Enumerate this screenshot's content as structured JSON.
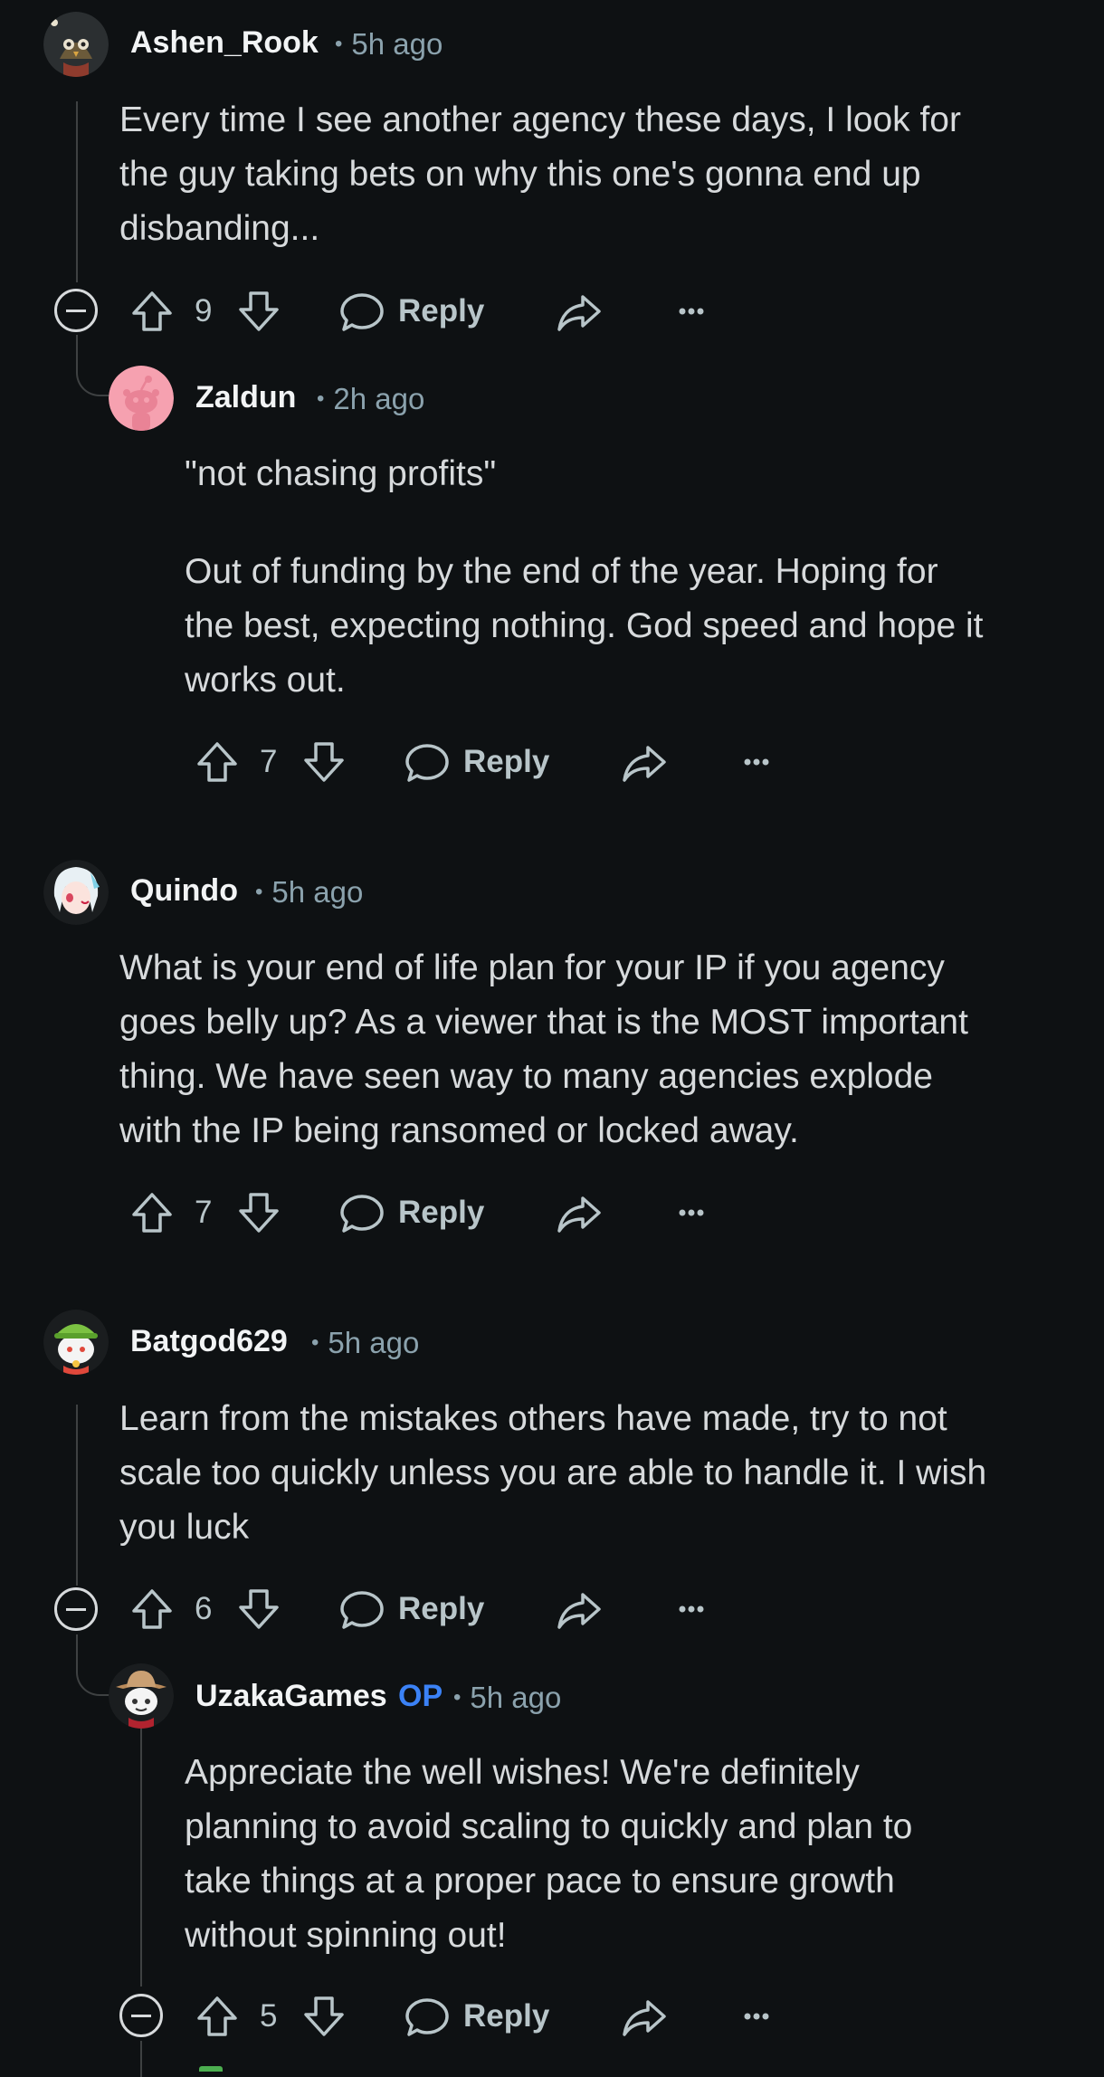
{
  "comments": [
    {
      "username": "Ashen_Rook",
      "time": "5h ago",
      "body": [
        "Every time I see another agency these days, I look for",
        "the guy taking bets on why this one's gonna end up",
        "disbanding..."
      ],
      "votes": "9",
      "reply_label": "Reply",
      "avatar_icon": "owl-avatar-icon"
    },
    {
      "username": "Zaldun",
      "time": "2h ago",
      "body": [
        "\"not chasing profits\""
      ],
      "body2": [
        "Out of funding by the end of the year. Hoping for",
        "the best, expecting nothing. God speed and hope it",
        "works out."
      ],
      "votes": "7",
      "reply_label": "Reply",
      "avatar_icon": "snoo-default-avatar-icon"
    },
    {
      "username": "Quindo",
      "time": "5h ago",
      "body": [
        "What is your end of life plan for your IP if you agency",
        "goes belly up? As a viewer that is the MOST important",
        "thing. We have seen way to many agencies explode",
        "with the IP being ransomed or locked away."
      ],
      "votes": "7",
      "reply_label": "Reply",
      "avatar_icon": "anime-girl-avatar-icon"
    },
    {
      "username": "Batgod629",
      "time": "5h ago",
      "body": [
        "Learn from the mistakes others have made, try to not",
        "scale too quickly unless you are able to handle it. I wish",
        "you luck"
      ],
      "votes": "6",
      "reply_label": "Reply",
      "avatar_icon": "green-hat-snoo-avatar-icon"
    },
    {
      "username": "UzakaGames",
      "op_badge": "OP",
      "time": "5h ago",
      "body": [
        "Appreciate the well wishes! We're definitely",
        "planning to avoid scaling to quickly and plan to",
        "take things at a proper pace to ensure growth",
        "without spinning out!"
      ],
      "votes": "5",
      "reply_label": "Reply",
      "avatar_icon": "cowboy-avatar-icon"
    }
  ],
  "colors": {
    "background": "#0e1113",
    "text": "#d7dadc",
    "meta": "#8ba2ad",
    "op_badge": "#3b82f6",
    "thread_line": "#3e4142"
  }
}
